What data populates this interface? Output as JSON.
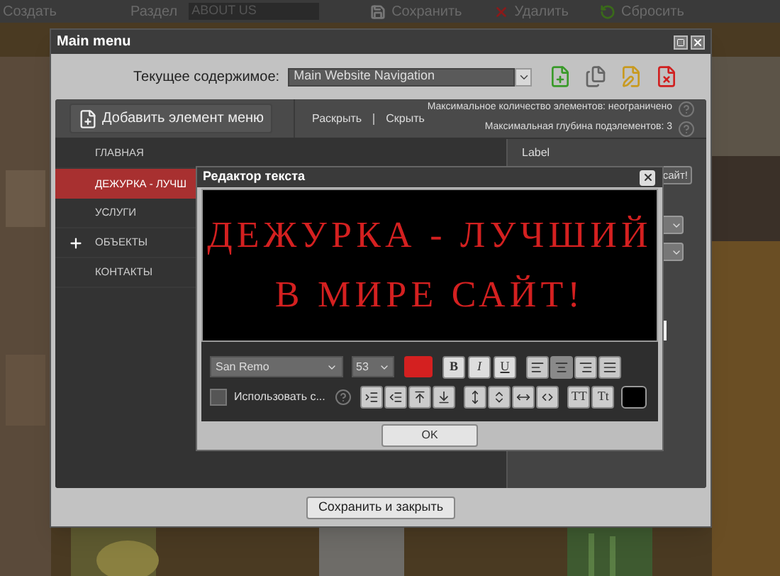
{
  "page_toolbar": {
    "create": "Создать",
    "section_label": "Раздел",
    "section_value": "ABOUT US",
    "actions": [
      {
        "kind": "save",
        "label": "Сохранить"
      },
      {
        "kind": "delete",
        "label": "Удалить"
      },
      {
        "kind": "reset",
        "label": "Сбросить"
      }
    ]
  },
  "window": {
    "title": "Main menu",
    "content_label": "Текущее содержимое:",
    "content_value": "Main Website Navigation",
    "add_item": "Добавить элемент меню",
    "links": [
      "Раскрыть",
      "Скрыть"
    ],
    "info": [
      "Максимальное количество элементов: неограничено",
      "Максимальная глубина подэлементов: 3"
    ],
    "items": [
      {
        "label": "ГЛАВНАЯ",
        "selected": false,
        "has_children": false
      },
      {
        "label": "ДЕЖУРКА - ЛУЧШ",
        "selected": true,
        "has_children": false
      },
      {
        "label": "УСЛУГИ",
        "selected": false,
        "has_children": false
      },
      {
        "label": "ОБЪЕКТЫ",
        "selected": false,
        "has_children": true
      },
      {
        "label": "КОНТАКТЫ",
        "selected": false,
        "has_children": false
      }
    ],
    "side_label": "Label",
    "side_field": "сайт!",
    "save_button": "Сохранить и закрыть"
  },
  "dialog": {
    "title": "Редактор текста",
    "preview_lines": [
      "ДЕЖУРКА - ЛУЧШИЙ",
      "В МИРЕ САЙТ!"
    ],
    "font": "San Remo",
    "size": "53",
    "color_buttons": [
      {
        "kind": "text",
        "color": "#d42020"
      },
      {
        "kind": "background",
        "color": "#000000"
      }
    ],
    "styles": [
      {
        "label": "B",
        "on": false
      },
      {
        "label": "I",
        "on": false
      },
      {
        "label": "U",
        "on": false
      }
    ],
    "align": [
      {
        "kind": "left",
        "selected": false
      },
      {
        "kind": "center",
        "selected": true
      },
      {
        "kind": "right",
        "selected": false
      },
      {
        "kind": "justify",
        "selected": false
      }
    ],
    "checkbox": {
      "label": "Использовать с...",
      "checked": false
    },
    "case_buttons": [
      "TT",
      "Tt"
    ],
    "ok": "OK"
  }
}
